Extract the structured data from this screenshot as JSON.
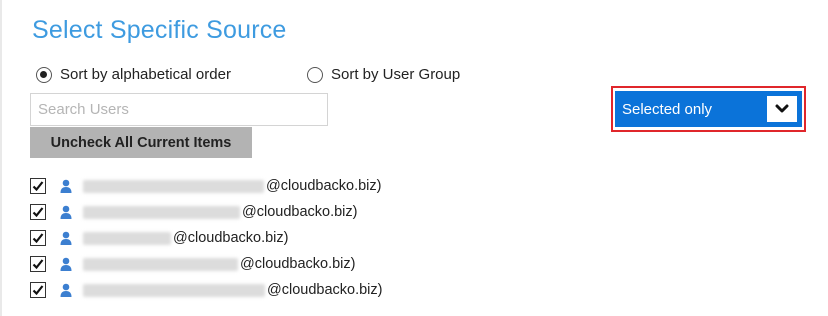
{
  "section": {
    "title": "Select Specific Source"
  },
  "sort": {
    "options": [
      {
        "label": "Sort by alphabetical order",
        "checked": true
      },
      {
        "label": "Sort by User Group",
        "checked": false
      }
    ]
  },
  "search": {
    "placeholder": "Search Users",
    "value": ""
  },
  "uncheck_button": {
    "label": "Uncheck All Current Items"
  },
  "filter_select": {
    "selected": "Selected only",
    "highlight_color": "#e0262b",
    "background_color": "#0b73d9"
  },
  "users": [
    {
      "checked": true,
      "domain": "@cloudbacko.biz)",
      "icon": "user-icon"
    },
    {
      "checked": true,
      "domain": "@cloudbacko.biz)",
      "icon": "user-icon"
    },
    {
      "checked": true,
      "domain": "@cloudbacko.biz)",
      "icon": "user-icon"
    },
    {
      "checked": true,
      "domain": "@cloudbacko.biz)",
      "icon": "user-icon"
    },
    {
      "checked": true,
      "domain": "@cloudbacko.biz)",
      "icon": "user-icon"
    }
  ],
  "colors": {
    "title": "#3e9be0",
    "user_icon": "#3c7fd0"
  }
}
